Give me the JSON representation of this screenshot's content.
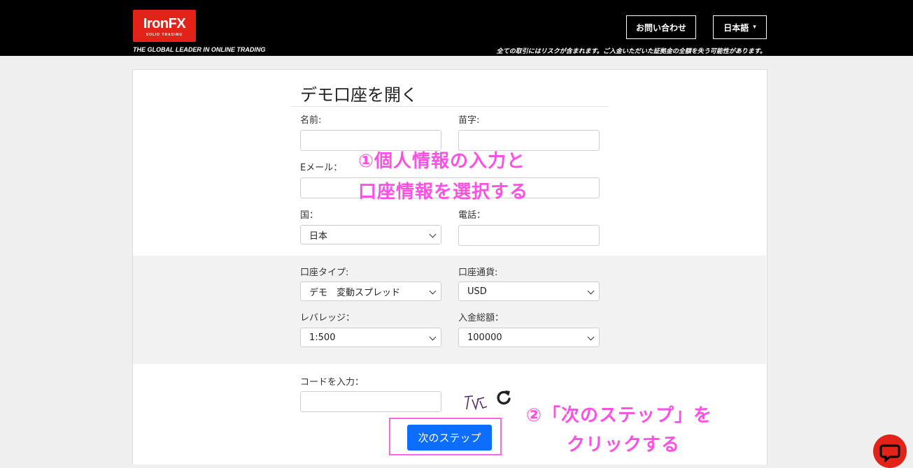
{
  "header": {
    "logo_main": "IronFX",
    "logo_sub": "SOLID TRADING",
    "tagline": "THE GLOBAL LEADER IN ONLINE TRADING",
    "risk_warning": "全ての取引にはリスクが含まれます。ご入金いただいた証拠金の全額を失う可能性があります。",
    "contact_label": "お問い合わせ",
    "language_label": "日本語"
  },
  "form": {
    "title": "デモ口座を開く",
    "first_name_label": "名前:",
    "last_name_label": "苗字:",
    "email_label": "Eメール：",
    "country_label": "国：",
    "country_value": "日本",
    "phone_label": "電話：",
    "account_type_label": "口座タイプ:",
    "account_type_value": "デモ　変動スプレッド",
    "currency_label": "口座通貨:",
    "currency_value": "USD",
    "leverage_label": "レバレッジ：",
    "leverage_value": "1:500",
    "deposit_label": "入金総額：",
    "deposit_value": "100000",
    "code_label": "コードを入力：",
    "next_button": "次のステップ"
  },
  "annotations": {
    "step1_line1": "①個人情報の入力と",
    "step1_line2": "口座情報を選択する",
    "step2_line1": "②「次のステップ」を",
    "step2_line2": "クリックする"
  },
  "colors": {
    "brand_red": "#e2231a",
    "primary_blue": "#0d6efd",
    "annotation_pink": "#ff4fe4"
  }
}
